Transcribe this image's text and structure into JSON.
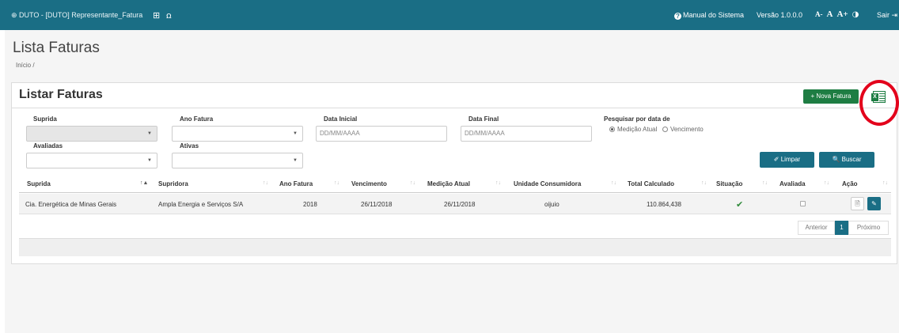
{
  "topbar": {
    "app_title": "⊕ DUTO - [DUTO] Representante_Fatura",
    "grid_icon": "⊞",
    "users_icon": "ꭥ",
    "manual_label": "Manual do Sistema",
    "version_label": "Versão 1.0.0.0",
    "font_decrease": "A-",
    "font_normal": "A",
    "font_increase": "A+",
    "contrast_icon": "◑",
    "exit_label": "Sair ⇥"
  },
  "page": {
    "title": "Lista Faturas",
    "breadcrumb": "Início /"
  },
  "panel": {
    "title": "Listar Faturas",
    "new_button": "+ Nova Fatura"
  },
  "filters": {
    "suprida_label": "Suprida",
    "ano_label": "Ano Fatura",
    "data_inicial_label": "Data Inicial",
    "data_inicial_placeholder": "DD/MM/AAAA",
    "data_final_label": "Data Final",
    "data_final_placeholder": "DD/MM/AAAA",
    "pesquisar_label": "Pesquisar por data de",
    "radio_medicao": "Medição Atual",
    "radio_vencimento": "Vencimento",
    "avaliadas_label": "Avaliadas",
    "ativas_label": "Ativas",
    "limpar_button": "✐ Limpar",
    "buscar_button": "🔍 Buscar"
  },
  "table": {
    "headers": [
      "Suprida",
      "Supridora",
      "Ano Fatura",
      "Vencimento",
      "Medição Atual",
      "Unidade Consumidora",
      "Total Calculado",
      "Situação",
      "Avaliada",
      "Ação"
    ],
    "rows": [
      {
        "suprida": "Cia. Energética de Minas Gerais",
        "supridora": "Ampla Energia e Serviços S/A",
        "ano": "2018",
        "vencimento": "26/11/2018",
        "medicao": "26/11/2018",
        "unidade": "oijuio",
        "total": "110.864,438",
        "situacao_icon": "✔",
        "view_icon": "🗎",
        "edit_icon": "✎"
      }
    ]
  },
  "pagination": {
    "prev": "Anterior",
    "current": "1",
    "next": "Próximo"
  },
  "colors": {
    "topbar": "#1a6e85",
    "primary": "#1a6e85",
    "success": "#1e7d43",
    "annotation": "#e3001b"
  }
}
